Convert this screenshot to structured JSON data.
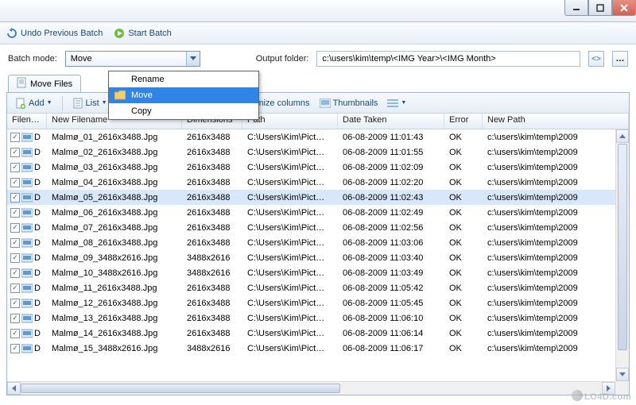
{
  "toolbar": {
    "undo_label": "Undo Previous Batch",
    "start_label": "Start Batch"
  },
  "opts": {
    "batch_mode_label": "Batch mode:",
    "batch_mode_value": "Move",
    "batch_mode_options": [
      "Rename",
      "Move",
      "Copy"
    ],
    "batch_mode_selected_index": 1,
    "output_folder_label": "Output folder:",
    "output_folder_value": "c:\\users\\kim\\temp\\<IMG Year>\\<IMG Month>"
  },
  "tab": {
    "label": "Move Files"
  },
  "list_toolbar": {
    "add_label": "Add",
    "list_label": "List",
    "customize_label": "Customize columns",
    "thumbnails_label": "Thumbnails"
  },
  "columns": [
    "Filen…",
    "New Filename",
    "Dimensions",
    "Path",
    "Date Taken",
    "Error",
    "New Path"
  ],
  "rows": [
    {
      "d": "D",
      "name": "Malmø_01_2616x3488.Jpg",
      "dim": "2616x3488",
      "path": "C:\\Users\\Kim\\Pict…",
      "date": "06-08-2009 11:01:43",
      "err": "OK",
      "np": "c:\\users\\kim\\temp\\2009"
    },
    {
      "d": "D",
      "name": "Malmø_02_2616x3488.Jpg",
      "dim": "2616x3488",
      "path": "C:\\Users\\Kim\\Pict…",
      "date": "06-08-2009 11:01:55",
      "err": "OK",
      "np": "c:\\users\\kim\\temp\\2009"
    },
    {
      "d": "D",
      "name": "Malmø_03_2616x3488.Jpg",
      "dim": "2616x3488",
      "path": "C:\\Users\\Kim\\Pict…",
      "date": "06-08-2009 11:02:09",
      "err": "OK",
      "np": "c:\\users\\kim\\temp\\2009"
    },
    {
      "d": "D",
      "name": "Malmø_04_2616x3488.Jpg",
      "dim": "2616x3488",
      "path": "C:\\Users\\Kim\\Pict…",
      "date": "06-08-2009 11:02:20",
      "err": "OK",
      "np": "c:\\users\\kim\\temp\\2009"
    },
    {
      "d": "D",
      "name": "Malmø_05_2616x3488.Jpg",
      "dim": "2616x3488",
      "path": "C:\\Users\\Kim\\Pict…",
      "date": "06-08-2009 11:02:43",
      "err": "OK",
      "np": "c:\\users\\kim\\temp\\2009",
      "sel": true
    },
    {
      "d": "D",
      "name": "Malmø_06_2616x3488.Jpg",
      "dim": "2616x3488",
      "path": "C:\\Users\\Kim\\Pict…",
      "date": "06-08-2009 11:02:49",
      "err": "OK",
      "np": "c:\\users\\kim\\temp\\2009"
    },
    {
      "d": "D",
      "name": "Malmø_07_2616x3488.Jpg",
      "dim": "2616x3488",
      "path": "C:\\Users\\Kim\\Pict…",
      "date": "06-08-2009 11:02:56",
      "err": "OK",
      "np": "c:\\users\\kim\\temp\\2009"
    },
    {
      "d": "D",
      "name": "Malmø_08_2616x3488.Jpg",
      "dim": "2616x3488",
      "path": "C:\\Users\\Kim\\Pict…",
      "date": "06-08-2009 11:03:06",
      "err": "OK",
      "np": "c:\\users\\kim\\temp\\2009"
    },
    {
      "d": "D",
      "name": "Malmø_09_3488x2616.Jpg",
      "dim": "3488x2616",
      "path": "C:\\Users\\Kim\\Pict…",
      "date": "06-08-2009 11:03:40",
      "err": "OK",
      "np": "c:\\users\\kim\\temp\\2009"
    },
    {
      "d": "D",
      "name": "Malmø_10_3488x2616.Jpg",
      "dim": "3488x2616",
      "path": "C:\\Users\\Kim\\Pict…",
      "date": "06-08-2009 11:03:49",
      "err": "OK",
      "np": "c:\\users\\kim\\temp\\2009"
    },
    {
      "d": "D",
      "name": "Malmø_11_2616x3488.Jpg",
      "dim": "2616x3488",
      "path": "C:\\Users\\Kim\\Pict…",
      "date": "06-08-2009 11:05:42",
      "err": "OK",
      "np": "c:\\users\\kim\\temp\\2009"
    },
    {
      "d": "D",
      "name": "Malmø_12_2616x3488.Jpg",
      "dim": "2616x3488",
      "path": "C:\\Users\\Kim\\Pict…",
      "date": "06-08-2009 11:05:45",
      "err": "OK",
      "np": "c:\\users\\kim\\temp\\2009"
    },
    {
      "d": "D",
      "name": "Malmø_13_2616x3488.Jpg",
      "dim": "2616x3488",
      "path": "C:\\Users\\Kim\\Pict…",
      "date": "06-08-2009 11:06:10",
      "err": "OK",
      "np": "c:\\users\\kim\\temp\\2009"
    },
    {
      "d": "D",
      "name": "Malmø_14_2616x3488.Jpg",
      "dim": "2616x3488",
      "path": "C:\\Users\\Kim\\Pict…",
      "date": "06-08-2009 11:06:14",
      "err": "OK",
      "np": "c:\\users\\kim\\temp\\2009"
    },
    {
      "d": "D",
      "name": "Malmø_15_3488x2616.Jpg",
      "dim": "3488x2616",
      "path": "C:\\Users\\Kim\\Pict…",
      "date": "06-08-2009 11:06:17",
      "err": "OK",
      "np": "c:\\users\\kim\\temp\\2009"
    }
  ],
  "watermark": "LO4D.com"
}
